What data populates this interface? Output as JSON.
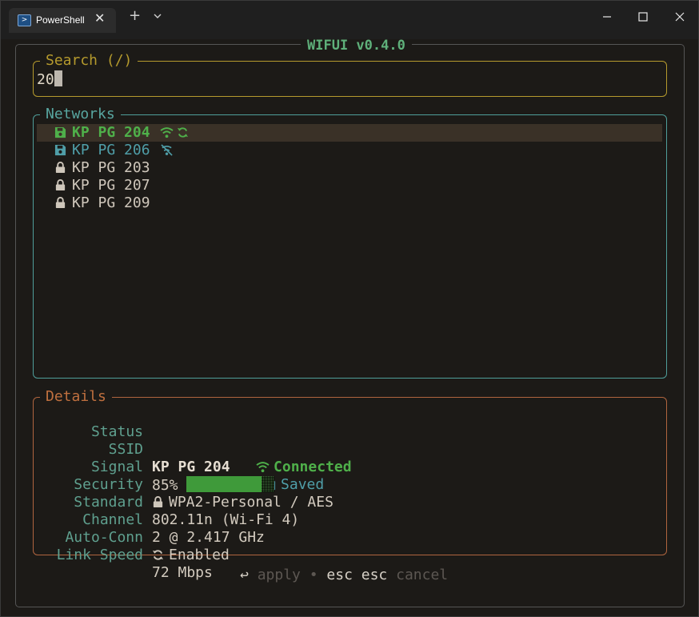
{
  "window": {
    "tab_title": "PowerShell",
    "new_tab": "+",
    "dropdown": "⌄",
    "close_tab": "✕",
    "minimize": "—",
    "maximize": "☐",
    "close": "✕"
  },
  "app": {
    "title": "WIFUI v0.4.0"
  },
  "search": {
    "title": "Search (/)",
    "value": "20"
  },
  "networks": {
    "title": "Networks",
    "items": [
      {
        "ssid": "KP PG 204",
        "icon": "save-icon",
        "status": "connected-selected",
        "extra_icons": [
          "wifi-icon",
          "autoconnect-icon"
        ]
      },
      {
        "ssid": "KP PG 206",
        "icon": "save-icon",
        "status": "saved",
        "extra_icons": [
          "wifi-off-icon"
        ]
      },
      {
        "ssid": "KP PG 203",
        "icon": "lock-icon",
        "status": "secured"
      },
      {
        "ssid": "KP PG 207",
        "icon": "lock-icon",
        "status": "secured"
      },
      {
        "ssid": "KP PG 209",
        "icon": "lock-icon",
        "status": "secured"
      }
    ]
  },
  "details": {
    "title": "Details",
    "status_label": "Status",
    "status_value": "Connected",
    "saved_value": "Saved",
    "ssid_label": "SSID",
    "ssid_value": "KP PG 204",
    "signal_label": "Signal",
    "signal_value": "85%",
    "signal_level": 0.85,
    "security_label": "Security",
    "security_value": "WPA2-Personal / AES",
    "standard_label": "Standard",
    "standard_value": "802.11n (Wi-Fi 4)",
    "channel_label": "Channel",
    "channel_value": "2 @ 2.417 GHz",
    "autoconn_label": "Auto-Conn",
    "autoconn_value": "Enabled",
    "linkspeed_label": "Link Speed",
    "linkspeed_value": "72 Mbps"
  },
  "footer": {
    "apply_icon": "↩",
    "apply": "apply",
    "separator": "•",
    "esc": "esc esc",
    "cancel": "cancel"
  },
  "colors": {
    "connected": "#4fb04a",
    "saved": "#4f9ea8",
    "search_border": "#b59a2d",
    "networks_border": "#4f9e9a",
    "details_border": "#b0653f"
  }
}
